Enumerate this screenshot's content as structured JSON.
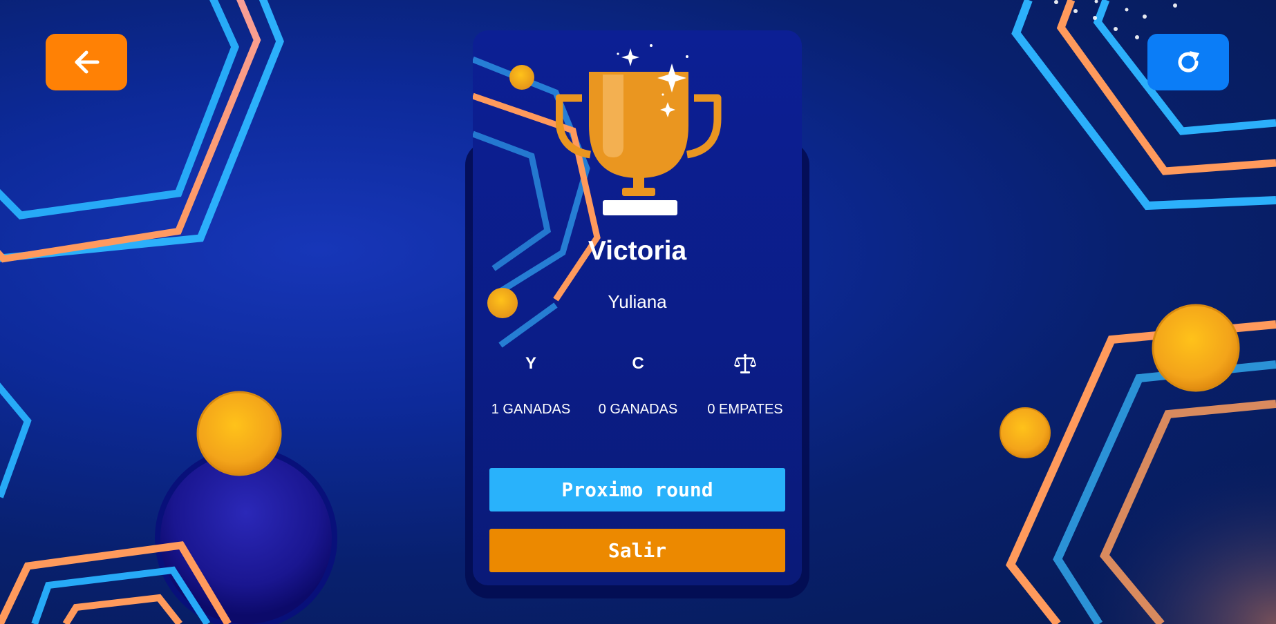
{
  "result": {
    "title": "Victoria",
    "winner_name": "Yuliana"
  },
  "scoreboard": [
    {
      "key": "player1",
      "label": "Y",
      "value": "1 GANADAS"
    },
    {
      "key": "player2",
      "label": "C",
      "value": "0 GANADAS"
    },
    {
      "key": "draws",
      "icon": "scale-icon",
      "value": "0 EMPATES"
    }
  ],
  "actions": {
    "next_round_label": "Proximo round",
    "exit_label": "Salir"
  },
  "toolbar": {
    "back_icon": "arrow-left-icon",
    "restart_icon": "restart-icon"
  },
  "theme": {
    "back_button_color": "#ff8105",
    "restart_button_color": "#0b7df7",
    "next_button_color": "#29b2fb",
    "exit_button_color": "#ec8900",
    "trophy_color": "#ea9620",
    "background_color": "#0a2384"
  }
}
